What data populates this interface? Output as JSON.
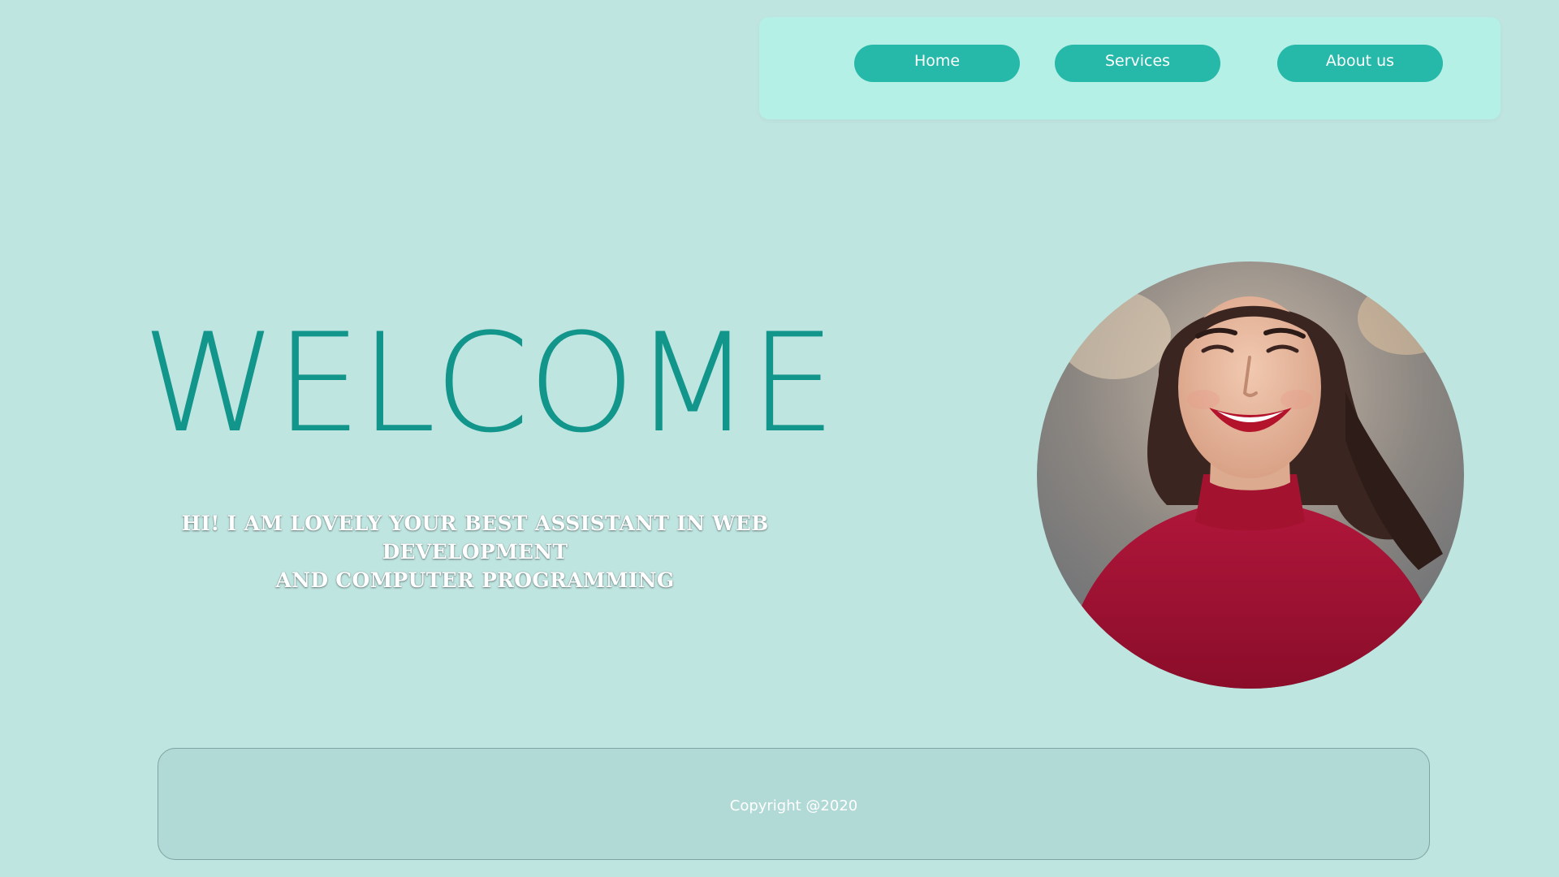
{
  "nav": {
    "items": [
      {
        "label": "Home"
      },
      {
        "label": "Services"
      },
      {
        "label": "About us"
      }
    ]
  },
  "hero": {
    "title": "WELCOME",
    "tagline_line1": "HI! I AM LOVELY  YOUR BEST ASSISTANT IN WEB DEVELOPMENT",
    "tagline_line2": "AND COMPUTER PROGRAMMING"
  },
  "footer": {
    "copyright": "Copyright @2020"
  },
  "colors": {
    "background": "#bfe5e1",
    "nav_background": "#b5f0e6",
    "button": "#26b9a9",
    "title": "#12958a",
    "footer_background": "#b1d9d6"
  },
  "icons": {
    "avatar": "profile-photo"
  }
}
